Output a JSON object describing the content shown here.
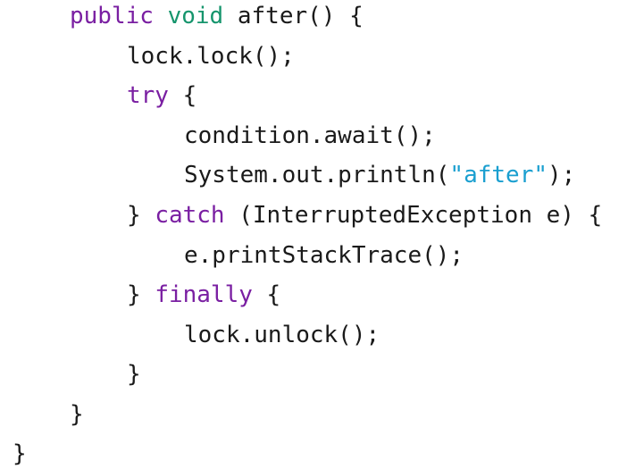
{
  "code": {
    "l1": {
      "kw": "public",
      "sp1": " ",
      "type": "void",
      "rest": " after() {"
    },
    "l2": {
      "text": "lock.lock();"
    },
    "l3": {
      "kw": "try",
      "rest": " {"
    },
    "l4": {
      "text": "condition.await();"
    },
    "l5": {
      "pre": "System.out.println(",
      "str": "\"after\"",
      "post": ");"
    },
    "l6": {
      "pre": "} ",
      "kw": "catch",
      "rest": " (InterruptedException e) {"
    },
    "l7": {
      "text": "e.printStackTrace();"
    },
    "l8": {
      "pre": "} ",
      "kw": "finally",
      "rest": " {"
    },
    "l9": {
      "text": "lock.unlock();"
    },
    "l10": {
      "text": "}"
    },
    "l11": {
      "text": "}"
    },
    "l12": {
      "text": "}"
    }
  },
  "colors": {
    "keyword": "#7a1fa2",
    "type": "#16956d",
    "string": "#1a9fd0",
    "plain": "#1a1a1a",
    "background": "#ffffff"
  }
}
